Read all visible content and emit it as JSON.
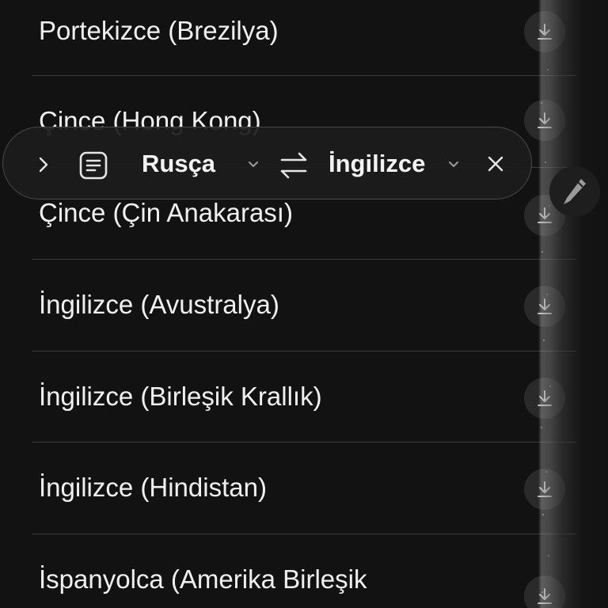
{
  "language_list": {
    "items": [
      {
        "label": "Portekizce (Brezilya)",
        "icon": "download-icon"
      },
      {
        "label": "Çince (Hong Kong)",
        "icon": "download-icon"
      },
      {
        "label": "Çince (Çin Anakarası)",
        "icon": "download-icon"
      },
      {
        "label": "İngilizce (Avustralya)",
        "icon": "download-icon"
      },
      {
        "label": "İngilizce (Birleşik Krallık)",
        "icon": "download-icon"
      },
      {
        "label": "İngilizce (Hindistan)",
        "icon": "download-icon"
      },
      {
        "label": "İspanyolca (Amerika Birleşik",
        "icon": "download-icon"
      }
    ]
  },
  "translate_bar": {
    "source_language": "Rusça",
    "target_language": "İngilizce",
    "icons": [
      "chevron-right-icon",
      "document-icon",
      "chevron-down-icon",
      "swap-icon",
      "close-icon"
    ]
  },
  "floating_action": {
    "icon": "pencil-icon"
  },
  "colors": {
    "background": "#121212",
    "text": "#f0f0f0",
    "divider": "#3a3a3a",
    "bar_background": "#1c1c1c"
  }
}
